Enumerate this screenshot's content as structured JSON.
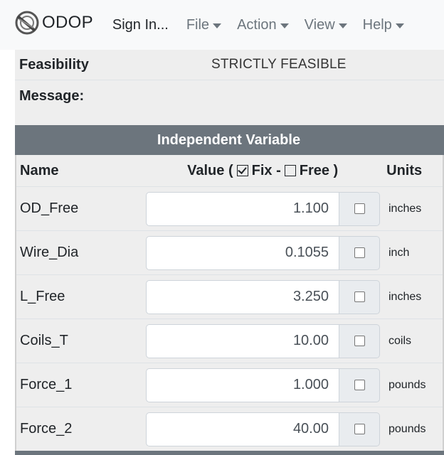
{
  "navbar": {
    "brand": "ODOP",
    "brand_icon": "odop-logo-icon",
    "items": [
      {
        "label": "Sign In...",
        "dropdown": false
      },
      {
        "label": "File",
        "dropdown": true
      },
      {
        "label": "Action",
        "dropdown": true
      },
      {
        "label": "View",
        "dropdown": true
      },
      {
        "label": "Help",
        "dropdown": true
      }
    ]
  },
  "status": {
    "feasibility_label": "Feasibility",
    "feasibility_value": "STRICTLY FEASIBLE",
    "message_label": "Message:",
    "message_value": ""
  },
  "independent": {
    "title": "Independent Variable",
    "col_name": "Name",
    "col_value_prefix": "Value (",
    "col_value_fix": "Fix -",
    "col_value_free": "Free )",
    "col_units": "Units",
    "rows": [
      {
        "name": "OD_Free",
        "value": "1.100",
        "fixed": false,
        "units": "inches"
      },
      {
        "name": "Wire_Dia",
        "value": "0.1055",
        "fixed": false,
        "units": "inch"
      },
      {
        "name": "L_Free",
        "value": "3.250",
        "fixed": false,
        "units": "inches"
      },
      {
        "name": "Coils_T",
        "value": "10.00",
        "fixed": false,
        "units": "coils"
      },
      {
        "name": "Force_1",
        "value": "1.000",
        "fixed": false,
        "units": "pounds"
      },
      {
        "name": "Force_2",
        "value": "40.00",
        "fixed": false,
        "units": "pounds"
      }
    ]
  },
  "colors": {
    "navbar_bg": "#f8f9fa",
    "header_bg": "#6c757d",
    "table_bg": "#eeeeee",
    "addon_bg": "#e9ecef"
  }
}
